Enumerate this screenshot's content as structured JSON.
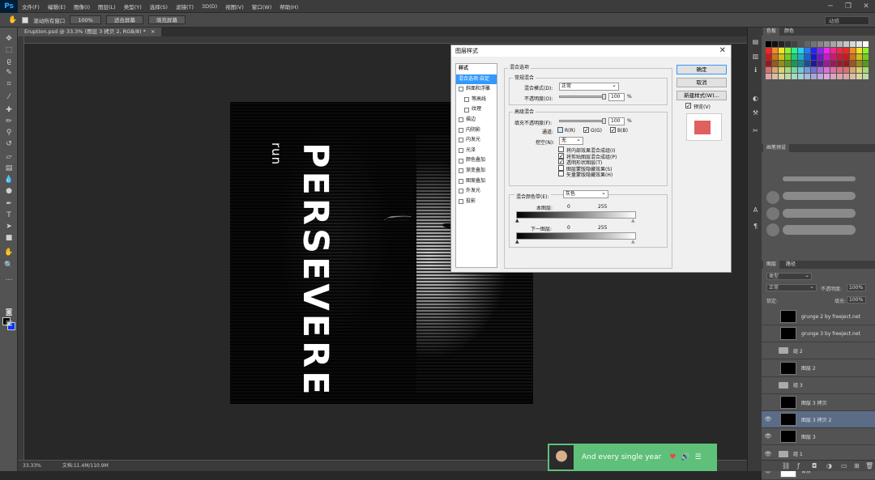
{
  "app": {
    "logo": "Ps"
  },
  "menu": [
    "文件(F)",
    "编辑(E)",
    "图像(I)",
    "图层(L)",
    "类型(Y)",
    "选择(S)",
    "滤镜(T)",
    "3D(D)",
    "视图(V)",
    "窗口(W)",
    "帮助(H)"
  ],
  "window_controls": [
    "─",
    "❐",
    "✕"
  ],
  "options": {
    "scroll_all": "滚动所有窗口",
    "zoom": "100%",
    "fit_screen": "适合屏幕",
    "fill_screen": "填充屏幕",
    "workspace": "动感"
  },
  "document": {
    "tab": "Eruption.psd @ 33.3% (图层 3 拷贝 2, RGB/8) *",
    "tab_close": "×"
  },
  "canvas_text": {
    "main": "PERSEVERE",
    "sub": "run"
  },
  "dialog": {
    "title": "图层样式",
    "close": "✕",
    "styles": [
      {
        "label": "样式",
        "type": "header"
      },
      {
        "label": "混合选项:自定",
        "type": "selected"
      },
      {
        "label": "斜面和浮雕",
        "type": "check"
      },
      {
        "label": "等高线",
        "type": "sub"
      },
      {
        "label": "纹理",
        "type": "sub"
      },
      {
        "label": "描边",
        "type": "check"
      },
      {
        "label": "内阴影",
        "type": "check"
      },
      {
        "label": "内发光",
        "type": "check"
      },
      {
        "label": "光泽",
        "type": "check"
      },
      {
        "label": "颜色叠加",
        "type": "check"
      },
      {
        "label": "渐变叠加",
        "type": "check"
      },
      {
        "label": "图案叠加",
        "type": "check"
      },
      {
        "label": "外发光",
        "type": "check"
      },
      {
        "label": "投影",
        "type": "check"
      }
    ],
    "blend_section": "混合选项",
    "general_blend": "常规混合",
    "blend_mode_label": "混合模式(D):",
    "blend_mode": "正常",
    "opacity_label": "不透明度(O):",
    "opacity": "100",
    "percent": "%",
    "advanced_blend": "高级混合",
    "fill_opacity_label": "填充不透明度(F):",
    "fill_opacity": "100",
    "channels_label": "通道:",
    "channel_r": "R(R)",
    "channel_g": "G(G)",
    "channel_b": "B(B)",
    "knockout_label": "挖空(N):",
    "knockout": "无",
    "adv_options": [
      {
        "label": "将内部效果混合成组(I)",
        "checked": false
      },
      {
        "label": "将剪贴图层混合成组(P)",
        "checked": true
      },
      {
        "label": "透明形状图层(T)",
        "checked": true
      },
      {
        "label": "图层蒙版隐藏效果(S)",
        "checked": false
      },
      {
        "label": "矢量蒙版隐藏效果(H)",
        "checked": false
      }
    ],
    "blend_if_label": "混合颜色带(E):",
    "blend_if": "灰色",
    "this_layer": "本图层:",
    "under_layer": "下一图层:",
    "v0": "0",
    "v255": "255",
    "ok": "确定",
    "cancel": "取消",
    "new_style": "新建样式(W)...",
    "preview": "预览(V)",
    "preview_color": "#e06060"
  },
  "panels": {
    "swatch_tabs": [
      "色板",
      "颜色"
    ],
    "brush_tab": "画笔预设",
    "layers_tab": "图层",
    "paths_tab": "路径",
    "layer_kind": "类型",
    "blend": "正常",
    "opacity_label": "不透明度:",
    "opacity": "100%",
    "lock_label": "锁定:",
    "fill_label": "填充:",
    "fill": "100%"
  },
  "layers": [
    {
      "name": "grunge 2 by freeject.net",
      "kind": "thumb",
      "visible": false
    },
    {
      "name": "grunge 3 by freeject.net",
      "kind": "thumb",
      "visible": false
    },
    {
      "name": "组 2",
      "kind": "group",
      "visible": false
    },
    {
      "name": "图层 2",
      "kind": "thumb",
      "visible": false
    },
    {
      "name": "组 3",
      "kind": "group",
      "visible": false
    },
    {
      "name": "图层 3 拷贝",
      "kind": "thumb",
      "visible": false
    },
    {
      "name": "图层 3 拷贝 2",
      "kind": "thumb",
      "visible": true,
      "selected": true
    },
    {
      "name": "图层 3",
      "kind": "thumb",
      "visible": true
    },
    {
      "name": "组 1",
      "kind": "group",
      "visible": true
    },
    {
      "name": "背景",
      "kind": "white",
      "visible": true
    }
  ],
  "status": {
    "zoom": "33.33%",
    "doc": "文档:11.4M/110.9M"
  },
  "music": {
    "song": "And every single year",
    "heart": "♥",
    "volume": "🔊",
    "menu": "☰"
  }
}
